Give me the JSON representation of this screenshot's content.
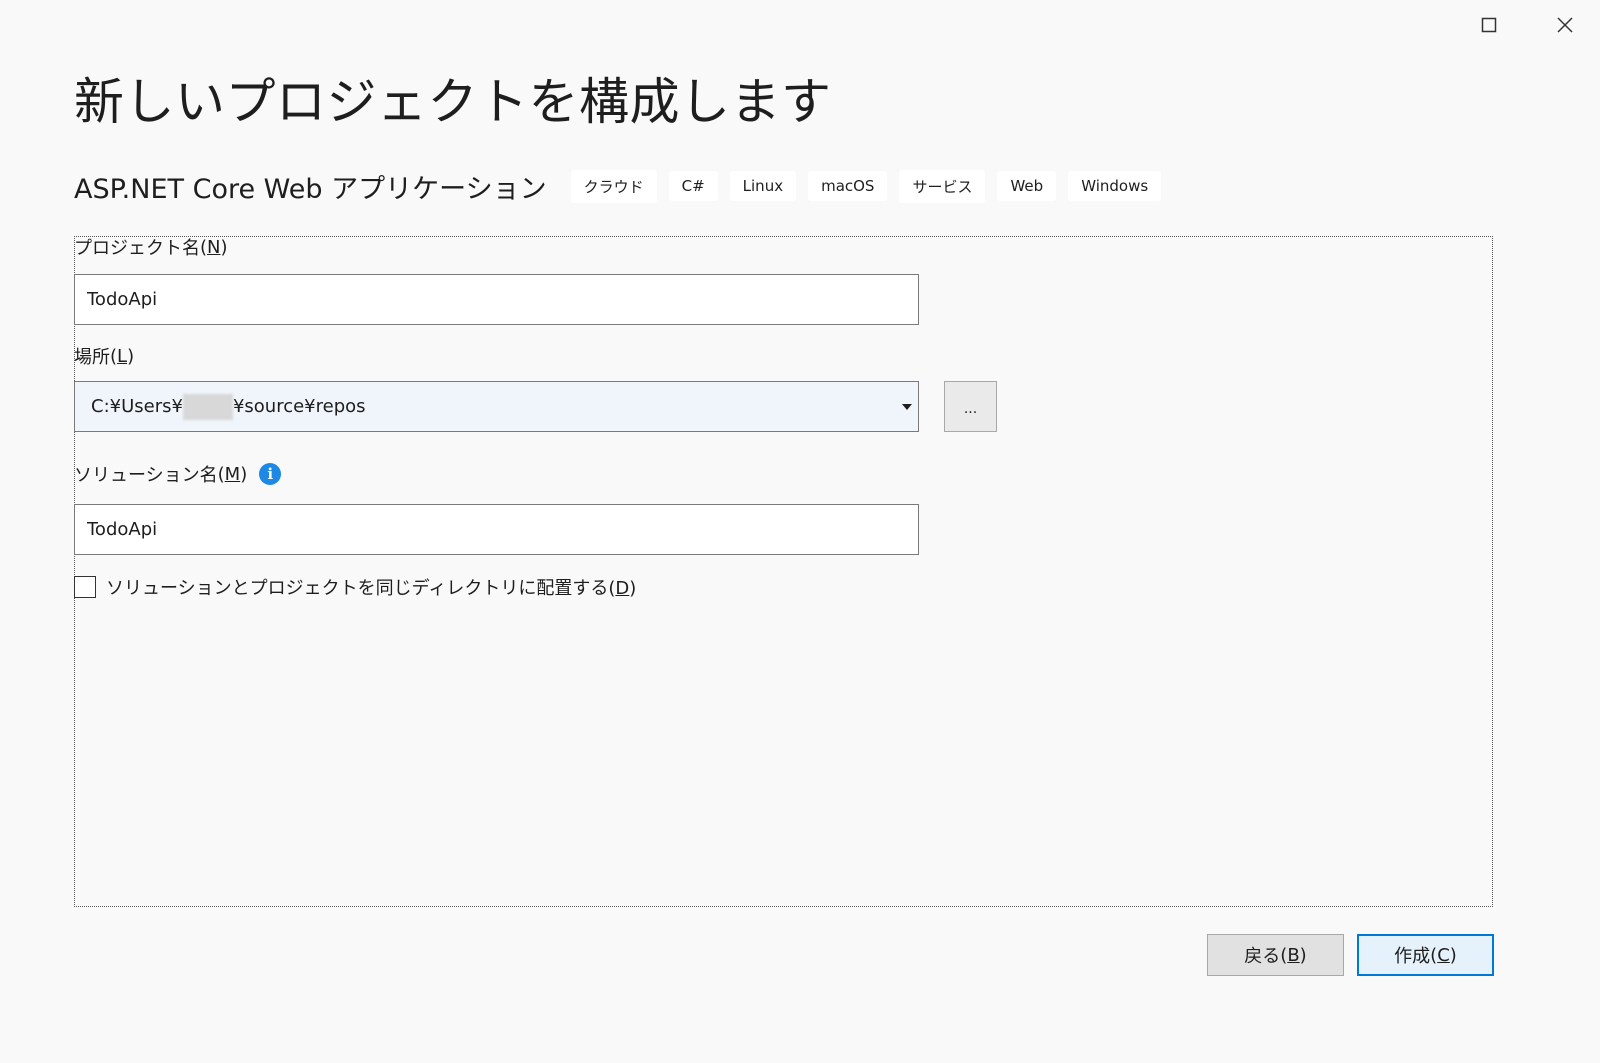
{
  "window": {
    "maximize_icon": "maximize-icon",
    "close_icon": "close-icon"
  },
  "page": {
    "title": "新しいプロジェクトを構成します"
  },
  "template": {
    "name": "ASP.NET Core Web アプリケーション",
    "tags": [
      "クラウド",
      "C#",
      "Linux",
      "macOS",
      "サービス",
      "Web",
      "Windows"
    ]
  },
  "form": {
    "project_name": {
      "label": "プロジェクト名",
      "accelerator": "N",
      "value": "TodoApi"
    },
    "location": {
      "label": "場所",
      "accelerator": "L",
      "value_prefix": "C:¥Users¥",
      "value_suffix": "¥source¥repos",
      "browse_label": "..."
    },
    "solution_name": {
      "label": "ソリューション名",
      "accelerator": "M",
      "value": "TodoApi",
      "info_icon": "info-icon"
    },
    "same_directory": {
      "label": "ソリューションとプロジェクトを同じディレクトリに配置する",
      "accelerator": "D",
      "checked": false
    }
  },
  "buttons": {
    "back": {
      "label": "戻る",
      "accelerator": "B"
    },
    "create": {
      "label": "作成",
      "accelerator": "C"
    }
  },
  "colors": {
    "background": "#f9f9f9",
    "info_icon": "#1e88e5",
    "focus_border": "#0078d7"
  }
}
